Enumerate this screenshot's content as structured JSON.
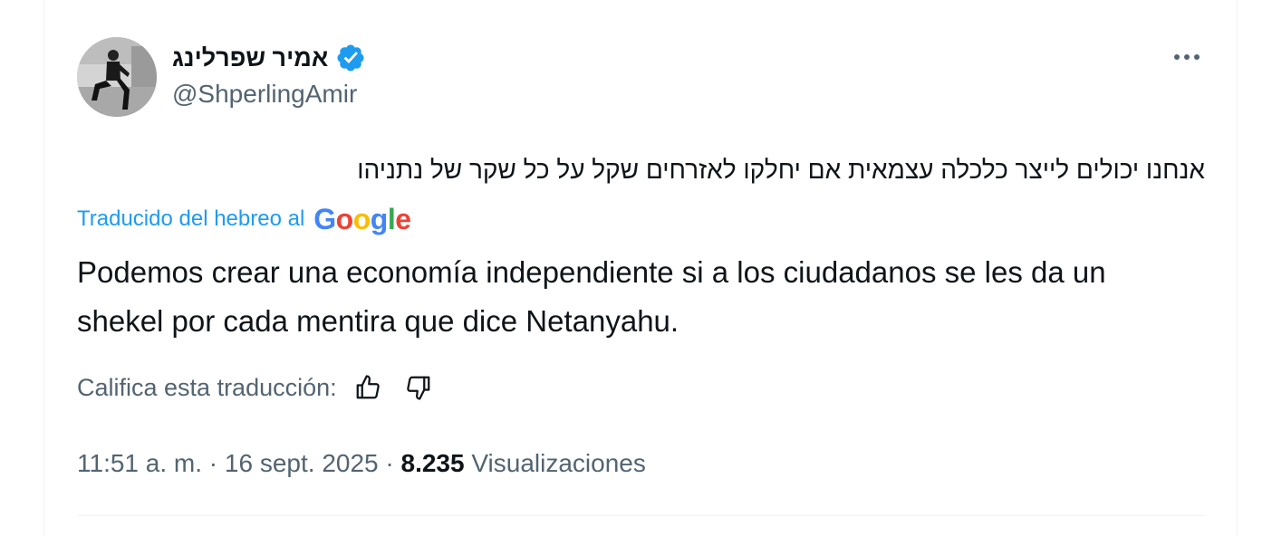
{
  "author": {
    "display_name": "אמיר שפרלינג",
    "handle": "@ShperlingAmir",
    "verified_icon": "verified-badge-icon",
    "avatar_icon": "profile-photo"
  },
  "menu": {
    "icon": "more-horizontal-icon"
  },
  "tweet": {
    "original_text": "אנחנו יכולים לייצר כלכלה עצמאית אם יחלקו לאזרחים שקל על כל שקר של נתניהו",
    "translated_label": "Traducido del hebreo al",
    "translator_brand": "Google",
    "translation": "Podemos crear una economía independiente si a los ciudadanos se les da un shekel por cada mentira que dice Netanyahu."
  },
  "rating": {
    "label": "Califica esta traducción:",
    "thumbs_up_icon": "thumbs-up-icon",
    "thumbs_down_icon": "thumbs-down-icon"
  },
  "meta": {
    "time": "11:51 a. m.",
    "separator": " · ",
    "date": "16 sept. 2025",
    "views_count": "8.235",
    "views_label": "Visualizaciones"
  },
  "colors": {
    "accent": "#1d9bf0",
    "text_primary": "#0f1419",
    "text_secondary": "#536471",
    "google_blue": "#4285F4",
    "google_red": "#EA4335",
    "google_yellow": "#FBBC05",
    "google_green": "#34A853"
  }
}
